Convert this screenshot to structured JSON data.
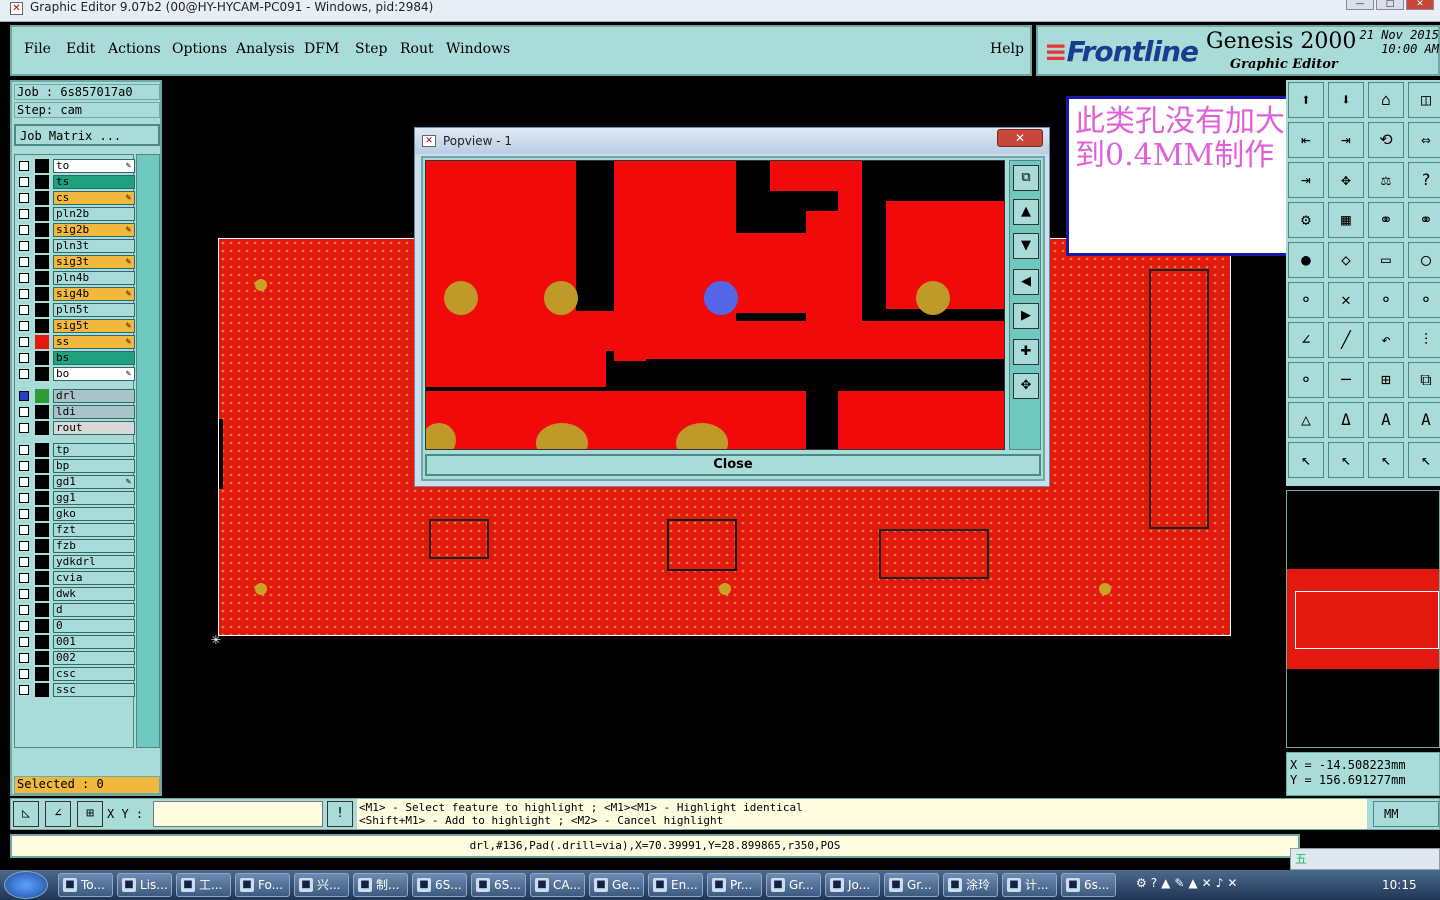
{
  "window": {
    "title": "Graphic Editor 9.07b2 (00@HY-HYCAM-PC091 - Windows, pid:2984)"
  },
  "menu": [
    "File",
    "Edit",
    "Actions",
    "Options",
    "Analysis",
    "DFM",
    "Step",
    "Rout",
    "Windows"
  ],
  "help_label": "Help",
  "brand": {
    "logo": "Frontline",
    "product": "Genesis 2000",
    "subtitle": "Graphic Editor",
    "date": "21 Nov 2015",
    "time": "10:00 AM"
  },
  "job": {
    "job_line": "Job : 6s857017a0",
    "step_line": "Step: cam",
    "matrix_button": "Job Matrix ..."
  },
  "layers": [
    {
      "name": "to",
      "color": "#ffffff",
      "editable": true
    },
    {
      "name": "ts",
      "color": "#1fa07e",
      "editable": false
    },
    {
      "name": "cs",
      "color": "#f0b83c",
      "editable": true
    },
    {
      "name": "pln2b",
      "color": "#a9dcd8",
      "editable": false
    },
    {
      "name": "sig2b",
      "color": "#f0b83c",
      "editable": true
    },
    {
      "name": "pln3t",
      "color": "#a9dcd8",
      "editable": false
    },
    {
      "name": "sig3t",
      "color": "#f0b83c",
      "editable": true
    },
    {
      "name": "pln4b",
      "color": "#a9dcd8",
      "editable": false
    },
    {
      "name": "sig4b",
      "color": "#f0b83c",
      "editable": true
    },
    {
      "name": "pln5t",
      "color": "#a9dcd8",
      "editable": false
    },
    {
      "name": "sig5t",
      "color": "#f0b83c",
      "editable": true
    },
    {
      "name": "ss",
      "color": "#f0b83c",
      "editable": true
    },
    {
      "name": "bs",
      "color": "#1fa07e",
      "editable": false
    },
    {
      "name": "bo",
      "color": "#ffffff",
      "editable": true
    },
    {
      "name": "drl",
      "color": "#a9c4c9",
      "editable": false
    },
    {
      "name": "ldi",
      "color": "#a9c4c9",
      "editable": false
    },
    {
      "name": "rout",
      "color": "#d8d8d8",
      "editable": false
    },
    {
      "name": "tp",
      "color": "#a9dcd8",
      "editable": false
    },
    {
      "name": "bp",
      "color": "#a9dcd8",
      "editable": false
    },
    {
      "name": "gd1",
      "color": "#a9dcd8",
      "editable": true
    },
    {
      "name": "gg1",
      "color": "#a9dcd8",
      "editable": false
    },
    {
      "name": "gko",
      "color": "#a9dcd8",
      "editable": false
    },
    {
      "name": "fzt",
      "color": "#a9dcd8",
      "editable": false
    },
    {
      "name": "fzb",
      "color": "#a9dcd8",
      "editable": false
    },
    {
      "name": "ydkdrl",
      "color": "#a9dcd8",
      "editable": false
    },
    {
      "name": "cvia",
      "color": "#a9dcd8",
      "editable": false
    },
    {
      "name": "dwk",
      "color": "#a9dcd8",
      "editable": false
    },
    {
      "name": "d",
      "color": "#a9dcd8",
      "editable": false
    },
    {
      "name": "0",
      "color": "#a9dcd8",
      "editable": false
    },
    {
      "name": "001",
      "color": "#a9dcd8",
      "editable": false
    },
    {
      "name": "002",
      "color": "#a9dcd8",
      "editable": false
    },
    {
      "name": "csc",
      "color": "#a9dcd8",
      "editable": false
    },
    {
      "name": "ssc",
      "color": "#a9dcd8",
      "editable": false
    }
  ],
  "selected": "Selected : 0",
  "popup": {
    "title": "Popview - 1",
    "close_label": "Close"
  },
  "note": "此类孔没有加大到0.4MM制作",
  "coords": {
    "x": "X = -14.508223mm",
    "y": "Y = 156.691277mm"
  },
  "xy_label": "X Y :",
  "hint_line1": "<M1> - Select feature to highlight ; <M1><M1> - Highlight identical",
  "hint_line2": "<Shift+M1> - Add to highlight ; <M2> - Cancel highlight",
  "unit": "MM",
  "status": "drl,#136,Pad(.drill=via),X=70.39991,Y=28.899865,r350,POS",
  "ime": "五",
  "taskbar": [
    "To...",
    "Lis...",
    "工...",
    "Fo...",
    "兴...",
    "制...",
    "6S...",
    "6S...",
    "CA...",
    "Ge...",
    "En...",
    "Pr...",
    "Gr...",
    "Jo...",
    "Gr...",
    "涂玲",
    "计...",
    "6s..."
  ],
  "clock": "10:15"
}
